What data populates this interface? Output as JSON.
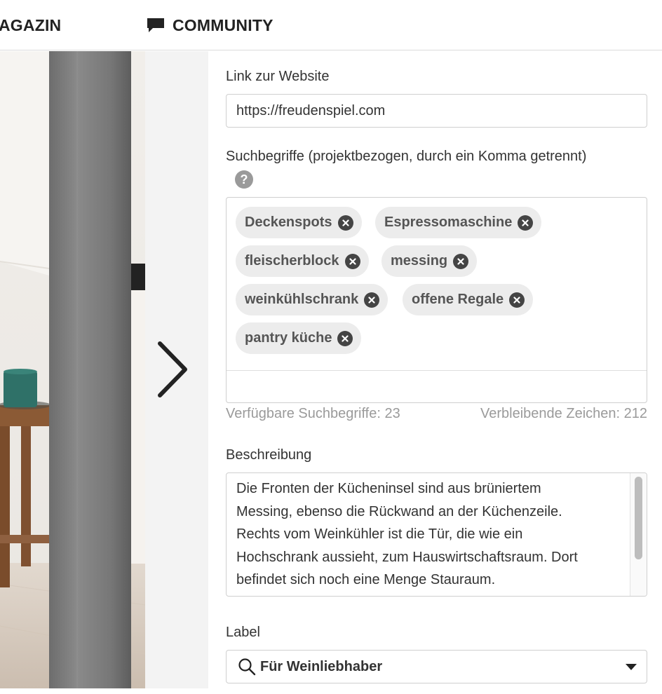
{
  "nav": {
    "magazin_label": "AGAZIN",
    "community_label": "COMMUNITY",
    "community_icon": "chat-bubble-icon"
  },
  "gallery": {
    "next_icon": "chevron-right-icon"
  },
  "form": {
    "website": {
      "label": "Link zur Website",
      "value": "https://freudenspiel.com"
    },
    "keywords": {
      "label": "Suchbegriffe (projektbezogen, durch ein Komma getrennt)",
      "help_icon": "?",
      "tags": [
        "Deckenspots",
        "Espressomaschine",
        "fleischerblock",
        "messing",
        "weinkühlschrank",
        "offene Regale",
        "pantry küche"
      ],
      "available": "Verfügbare Suchbegriffe: 23",
      "remaining": "Verbleibende Zeichen: 212"
    },
    "description": {
      "label": "Beschreibung",
      "lines": [
        "Die Fronten der Kücheninsel sind aus brüniertem",
        "Messing, ebenso die Rückwand an der Küchenzeile.",
        "Rechts vom Weinkühler ist die Tür, die wie ein",
        "Hochschrank aussieht, zum Hauswirtschaftsraum. Dort",
        "befindet sich noch eine Menge Stauraum."
      ]
    },
    "label_select": {
      "label": "Label",
      "value": "Für Weinliebhaber",
      "icon": "search-icon"
    }
  }
}
